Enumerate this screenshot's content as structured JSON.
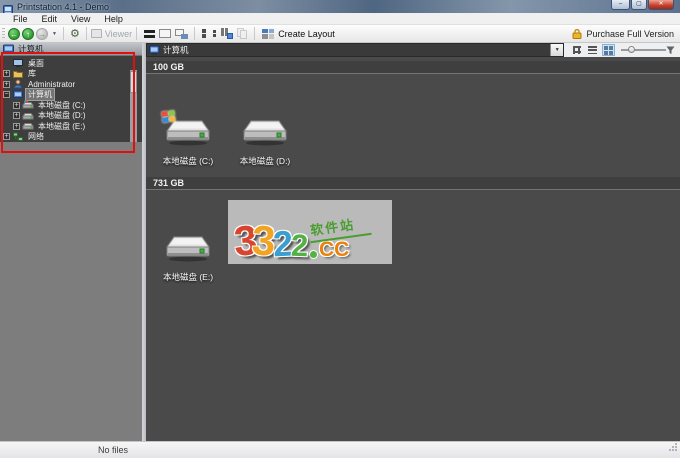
{
  "window": {
    "title": "Printstation 4.1 - Demo"
  },
  "window_controls": {
    "minimize": "–",
    "maximize": "▢",
    "close": "✕"
  },
  "menu": {
    "items": [
      "File",
      "Edit",
      "View",
      "Help"
    ]
  },
  "toolbar": {
    "viewer_label": "Viewer",
    "create_layout_label": "Create Layout",
    "purchase_label": "Purchase Full Version"
  },
  "icons": {
    "back": "←",
    "up": "↑",
    "forward": "→",
    "dropdown_caret": "▼",
    "settings_gear": "⚙",
    "combo_caret": "▼"
  },
  "left_panel": {
    "header": "计算机",
    "tree": [
      {
        "label": "桌面",
        "glyph": "",
        "level": 0,
        "selected": false
      },
      {
        "label": "库",
        "glyph": "+",
        "level": 0,
        "selected": false
      },
      {
        "label": "Administrator",
        "glyph": "+",
        "level": 0,
        "selected": false
      },
      {
        "label": "计算机",
        "glyph": "−",
        "level": 0,
        "selected": true
      },
      {
        "label": "本地磁盘 (C:)",
        "glyph": "+",
        "level": 1,
        "selected": false
      },
      {
        "label": "本地磁盘 (D:)",
        "glyph": "+",
        "level": 1,
        "selected": false
      },
      {
        "label": "本地磁盘 (E:)",
        "glyph": "+",
        "level": 1,
        "selected": false
      },
      {
        "label": "网络",
        "glyph": "+",
        "level": 0,
        "selected": false
      }
    ]
  },
  "main": {
    "address": "计算机",
    "groups": [
      {
        "title": "100 GB",
        "items": [
          {
            "label": "本地磁盘 (C:)",
            "os": true
          },
          {
            "label": "本地磁盘 (D:)",
            "os": false
          }
        ]
      },
      {
        "title": "731 GB",
        "items": [
          {
            "label": "本地磁盘 (E:)",
            "os": false
          }
        ]
      }
    ]
  },
  "watermark": {
    "d1": "3",
    "d2": "3",
    "d3": "2",
    "d4": "2",
    "cc": "CC",
    "site": "软件站"
  },
  "statusbar": {
    "text": "No files"
  },
  "colors": {
    "annotation_red": "#e20f0f",
    "tree_bg": "#3e3e3e",
    "content_bg": "#4a4a4a",
    "nav_green": "#2e9e2e",
    "purchase_gold": "#f0b428",
    "wm_red": "#d8452e",
    "wm_orange": "#f2a321",
    "wm_blue": "#3a9fd0",
    "wm_green": "#55b146",
    "wm_cc_orange": "#e8820c",
    "wm_site_green": "#4a9e2f"
  }
}
